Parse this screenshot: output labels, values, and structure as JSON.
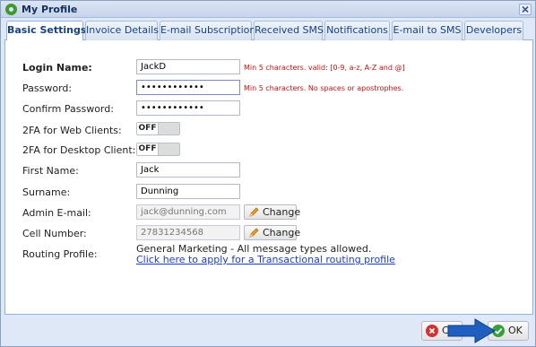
{
  "window": {
    "title": "My Profile"
  },
  "tabs": [
    {
      "label": "Basic Settings",
      "active": true
    },
    {
      "label": "Invoice Details",
      "active": false
    },
    {
      "label": "E-mail Subscription",
      "active": false
    },
    {
      "label": "Received SMS",
      "active": false
    },
    {
      "label": "Notifications",
      "active": false
    },
    {
      "label": "E-mail to SMS",
      "active": false
    },
    {
      "label": "Developers",
      "active": false
    }
  ],
  "form": {
    "login_name": {
      "label": "Login Name:",
      "value": "JackD",
      "hint": "Min 5 characters. valid: [0-9, a-z, A-Z and @]"
    },
    "password": {
      "label": "Password:",
      "value": "••••••••••••",
      "hint": "Min 5 characters. No spaces or apostrophes."
    },
    "confirm_password": {
      "label": "Confirm Password:",
      "value": "••••••••••••"
    },
    "twofa_web": {
      "label": "2FA for Web Clients:",
      "state": "OFF"
    },
    "twofa_desktop": {
      "label": "2FA for Desktop Client:",
      "state": "OFF"
    },
    "first_name": {
      "label": "First Name:",
      "value": "Jack"
    },
    "surname": {
      "label": "Surname:",
      "value": "Dunning"
    },
    "admin_email": {
      "label": "Admin E-mail:",
      "value": "jack@dunning.com",
      "button": "Change"
    },
    "cell_number": {
      "label": "Cell Number:",
      "value": "27831234568",
      "button": "Change"
    },
    "routing_profile": {
      "label": "Routing Profile:",
      "text": "General Marketing - All message types allowed.",
      "link": "Click here to apply for a Transactional routing profile"
    }
  },
  "footer": {
    "cancel_label": "Ca",
    "ok_label": "OK"
  },
  "colors": {
    "hint": "#cc1111",
    "link": "#1a3ccf",
    "accent": "#15428b",
    "arrow": "#1f5fbf"
  },
  "icons": {
    "title": "gear-icon",
    "close": "close-icon",
    "change": "pencil-icon",
    "cancel": "cancel-icon",
    "ok": "check-icon",
    "pointer": "arrow-icon"
  }
}
